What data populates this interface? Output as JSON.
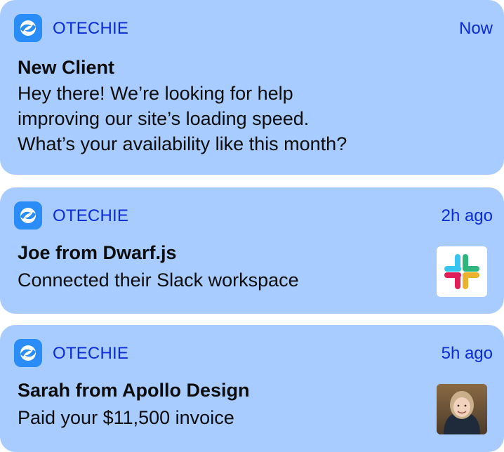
{
  "notifications": [
    {
      "app_icon": "otechie-logo-icon",
      "app_name": "OTECHIE",
      "time": "Now",
      "title": "New Client",
      "body_lines": [
        "Hey there! We’re looking for help",
        "improving our site’s loading speed.",
        "What’s your availability like this month?"
      ]
    },
    {
      "app_icon": "otechie-logo-icon",
      "app_name": "OTECHIE",
      "time": "2h ago",
      "title": "Joe from Dwarf.js",
      "body_lines": [
        "Connected their Slack workspace"
      ],
      "thumbnail": "slack-logo-icon"
    },
    {
      "app_icon": "otechie-logo-icon",
      "app_name": "OTECHIE",
      "time": "5h ago",
      "title": "Sarah from Apollo Design",
      "body_lines": [
        "Paid your $11,500 invoice"
      ],
      "thumbnail": "sarah-avatar"
    }
  ],
  "colors": {
    "card_background": "#a8ccff",
    "accent_text": "#0a2bd6",
    "app_icon": "#2a8df7",
    "primary_text": "#0d0d0d"
  }
}
